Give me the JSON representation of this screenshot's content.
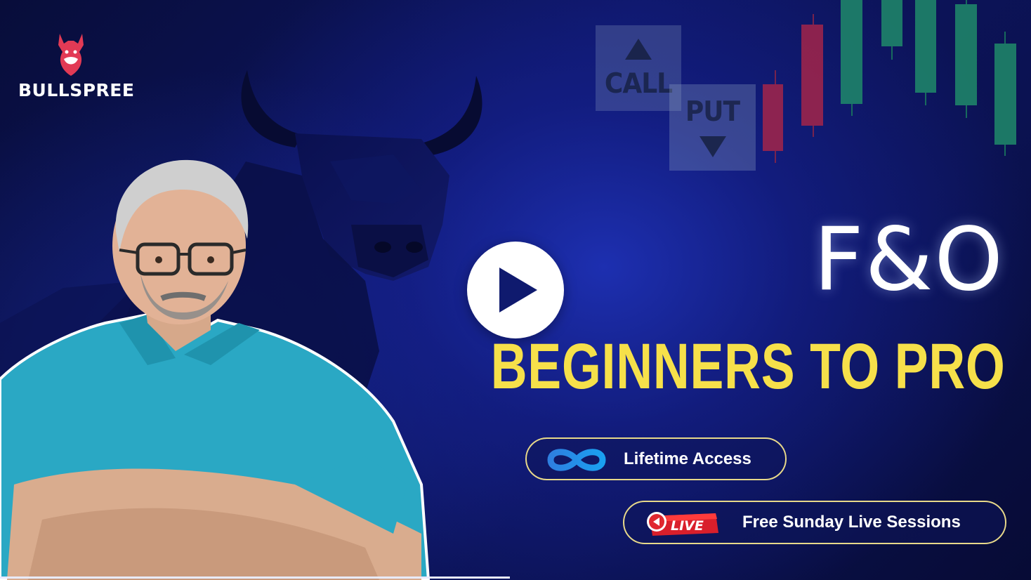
{
  "brand": {
    "name": "BULLSPREE"
  },
  "options": {
    "call_label": "CALL",
    "put_label": "PUT"
  },
  "title": {
    "main": "F&O",
    "sub": "BEGINNERS TO PRO"
  },
  "features": [
    {
      "label": "Lifetime Access",
      "icon": "infinity-icon"
    },
    {
      "label": "Free Sunday Live Sessions",
      "icon": "live-badge-icon",
      "badge": "LIVE"
    }
  ],
  "play": {
    "icon": "play-icon"
  },
  "colors": {
    "background": "#0a0f4a",
    "title_main": "#ffffff",
    "title_sub": "#f6e04a",
    "pill_border": "#e8d98a",
    "candle_green": "#1f8a6a",
    "candle_red": "#a3254a",
    "brand_red": "#e23a55"
  }
}
